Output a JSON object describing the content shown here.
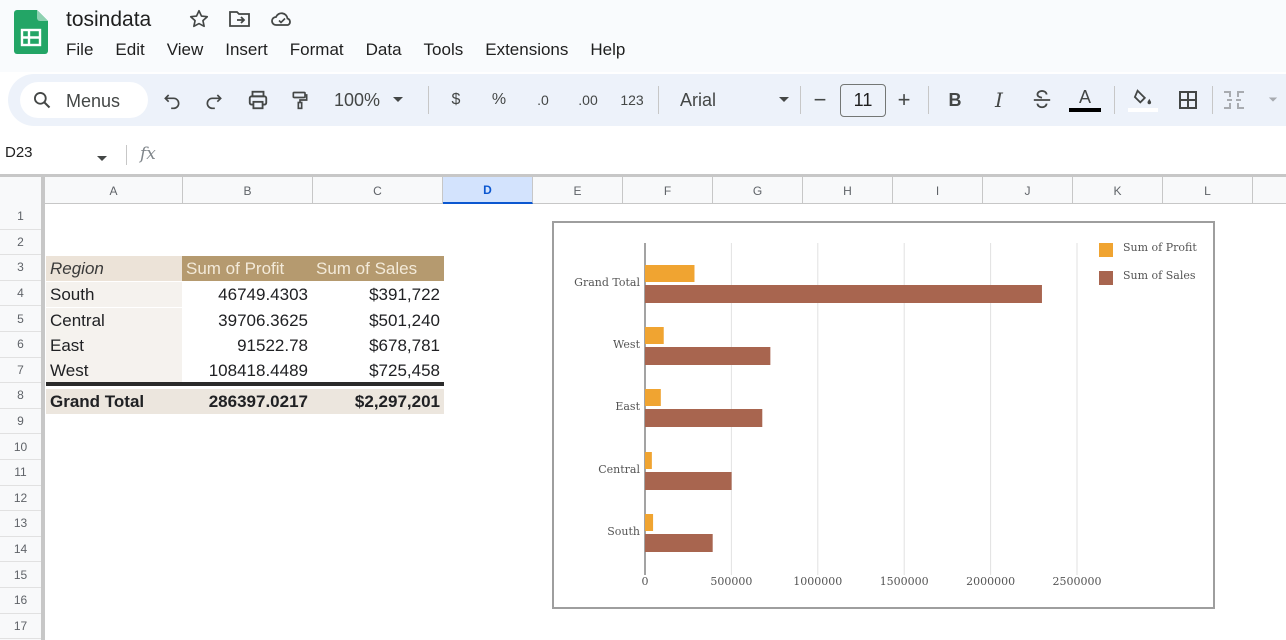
{
  "app": {
    "doc_title": "tosindata",
    "menu": [
      "File",
      "Edit",
      "View",
      "Insert",
      "Format",
      "Data",
      "Tools",
      "Extensions",
      "Help"
    ]
  },
  "toolbar": {
    "menus_label": "Menus",
    "zoom": "100%",
    "currency": "$",
    "percent": "%",
    "decrease_decimal": ".0",
    "increase_decimal": ".00",
    "number_format": "123",
    "font": "Arial",
    "font_size": "11",
    "minus": "−",
    "plus": "+",
    "bold": "B",
    "italic": "I",
    "text_color_letter": "A"
  },
  "formula_bar": {
    "cell_ref": "D23",
    "fx": "fx"
  },
  "grid": {
    "columns": [
      "A",
      "B",
      "C",
      "D",
      "E",
      "F",
      "G",
      "H",
      "I",
      "J",
      "K",
      "L"
    ],
    "selected_column": "D",
    "rows": [
      "1",
      "2",
      "3",
      "4",
      "5",
      "6",
      "7",
      "8",
      "9",
      "10",
      "11",
      "12",
      "13",
      "14",
      "15",
      "16",
      "17"
    ]
  },
  "pivot": {
    "headers": [
      "Region",
      "Sum of Profit",
      "Sum of Sales"
    ],
    "rows": [
      {
        "region": "South",
        "profit": "46749.4303",
        "sales": "$391,722"
      },
      {
        "region": "Central",
        "profit": "39706.3625",
        "sales": "$501,240"
      },
      {
        "region": "East",
        "profit": "91522.78",
        "sales": "$678,781"
      },
      {
        "region": "West",
        "profit": "108418.4489",
        "sales": "$725,458"
      }
    ],
    "grand": {
      "region": "Grand Total",
      "profit": "286397.0217",
      "sales": "$2,297,201"
    }
  },
  "colors": {
    "profit": "#f0a431",
    "sales": "#a8654f",
    "sheets_green": "#188038",
    "selected_col_bg": "#d3e3fd"
  },
  "chart_data": {
    "type": "bar",
    "orientation": "horizontal",
    "categories": [
      "Grand Total",
      "West",
      "East",
      "Central",
      "South"
    ],
    "series": [
      {
        "name": "Sum of Profit",
        "values": [
          286397.0217,
          108418.4489,
          91522.78,
          39706.3625,
          46749.4303
        ]
      },
      {
        "name": "Sum of Sales",
        "values": [
          2297201,
          725458,
          678781,
          501240,
          391722
        ]
      }
    ],
    "xticks": [
      "0",
      "500000",
      "1000000",
      "1500000",
      "2000000",
      "2500000"
    ],
    "xlim": [
      0,
      2500000
    ],
    "grid": true,
    "legend_position": "top-right"
  }
}
